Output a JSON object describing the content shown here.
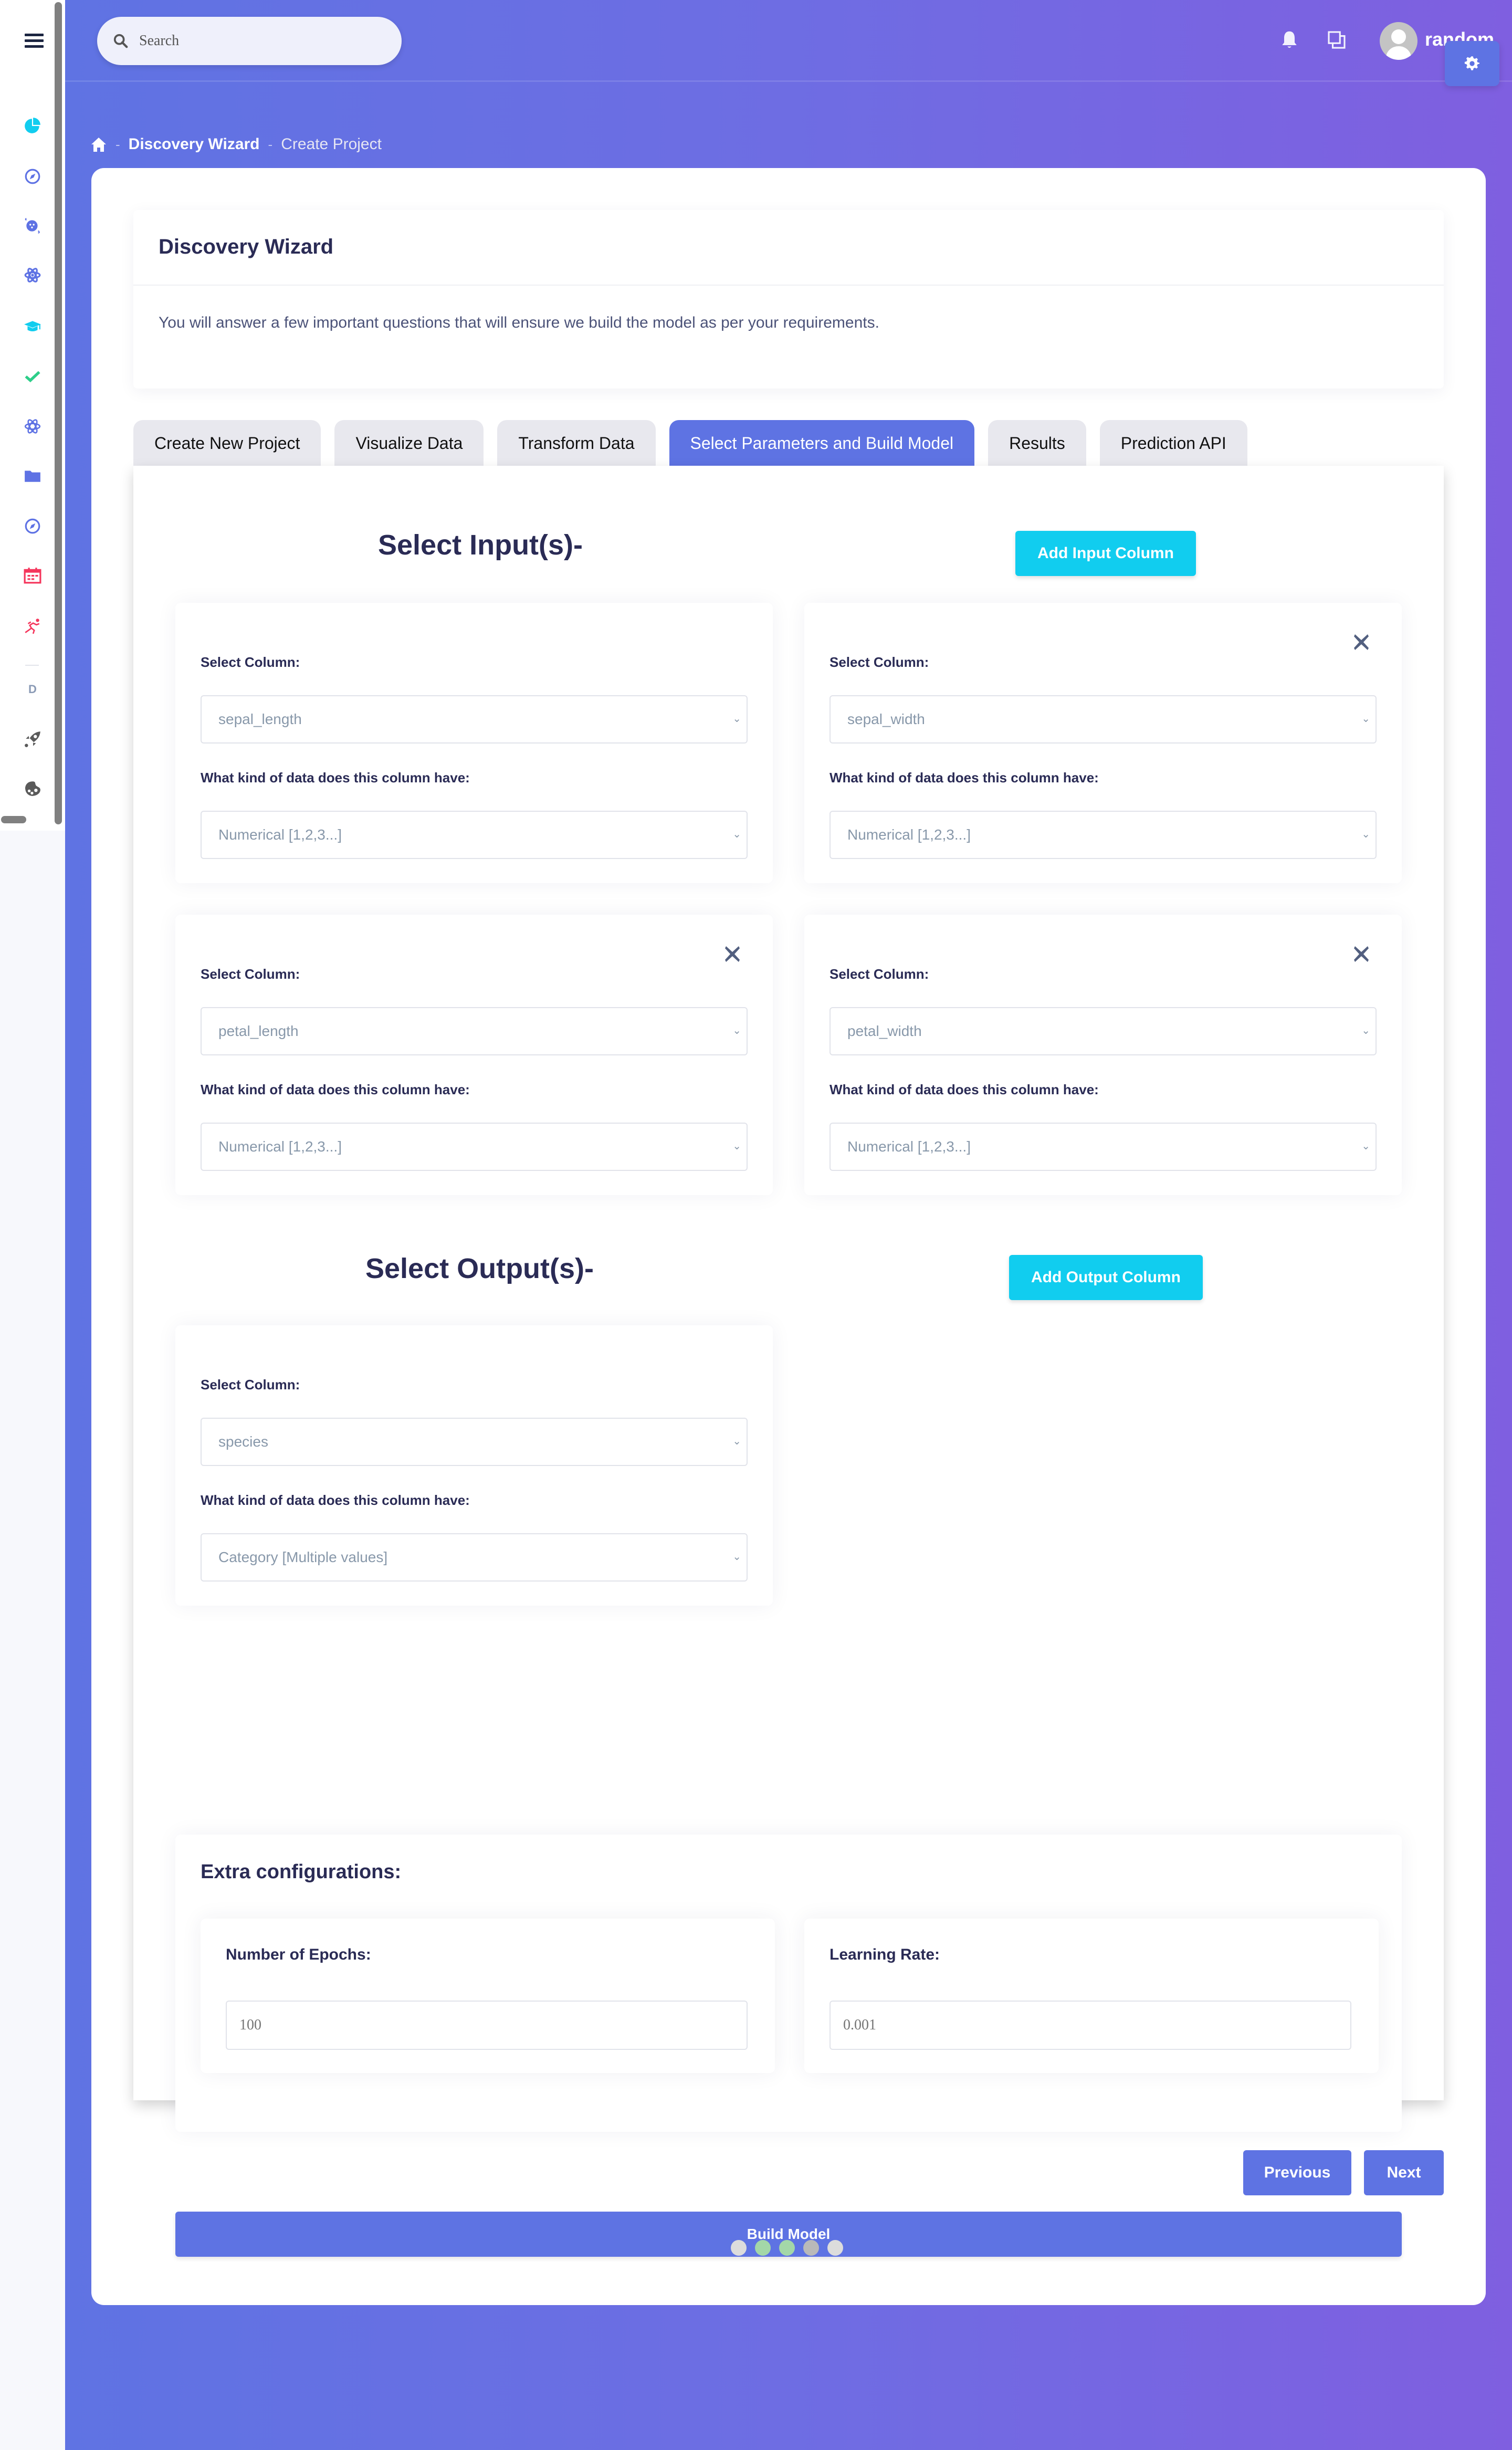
{
  "header": {
    "search_placeholder": "Search",
    "username": "random",
    "icons": [
      "bell-icon",
      "window-restore-icon",
      "user-avatar-icon",
      "gear-icon"
    ]
  },
  "sidebar": {
    "items": [
      {
        "icon": "pie-chart-icon",
        "color": "#11cdef"
      },
      {
        "icon": "compass-icon",
        "color": "#5e72e4"
      },
      {
        "icon": "planet-icon",
        "color": "#5e72e4"
      },
      {
        "icon": "atom-icon",
        "color": "#5e72e4"
      },
      {
        "icon": "graduation-cap-icon",
        "color": "#11cdef"
      },
      {
        "icon": "check-icon",
        "color": "#2dce89"
      },
      {
        "icon": "atom-icon",
        "color": "#5e72e4"
      },
      {
        "icon": "folder-icon",
        "color": "#5e72e4"
      },
      {
        "icon": "compass-icon",
        "color": "#5e72e4"
      },
      {
        "icon": "calendar-icon",
        "color": "#f5365c"
      },
      {
        "icon": "running-icon",
        "color": "#f5365c"
      }
    ],
    "section_letter": "D",
    "extra_items": [
      {
        "icon": "rocket-icon",
        "color": "#5a5a5a"
      },
      {
        "icon": "palette-icon",
        "color": "#5a5a5a"
      }
    ]
  },
  "breadcrumb": {
    "home_icon": "home-icon",
    "items": [
      "Discovery Wizard",
      "Create Project"
    ],
    "separator": "-"
  },
  "wizard": {
    "title": "Discovery Wizard",
    "description": "You will answer a few important questions that will ensure we build the model as per your requirements.",
    "tabs": [
      {
        "label": "Create New Project",
        "active": false
      },
      {
        "label": "Visualize Data",
        "active": false
      },
      {
        "label": "Transform Data",
        "active": false
      },
      {
        "label": "Select Parameters and Build Model",
        "active": true
      },
      {
        "label": "Results",
        "active": false
      },
      {
        "label": "Prediction API",
        "active": false
      }
    ]
  },
  "inputs": {
    "title": "Select Input(s)-",
    "add_button": "Add Input Column",
    "select_column_label": "Select Column:",
    "data_kind_label": "What kind of data does this column have:",
    "columns": [
      {
        "column": "sepal_length",
        "data_type": "Numerical [1,2,3...]",
        "removable": false
      },
      {
        "column": "sepal_width",
        "data_type": "Numerical [1,2,3...]",
        "removable": true
      },
      {
        "column": "petal_length",
        "data_type": "Numerical [1,2,3...]",
        "removable": true
      },
      {
        "column": "petal_width",
        "data_type": "Numerical [1,2,3...]",
        "removable": true
      }
    ]
  },
  "outputs": {
    "title": "Select Output(s)-",
    "add_button": "Add Output Column",
    "select_column_label": "Select Column:",
    "data_kind_label": "What kind of data does this column have:",
    "columns": [
      {
        "column": "species",
        "data_type": "Category [Multiple values]"
      }
    ]
  },
  "extra": {
    "title": "Extra configurations:",
    "epochs_label": "Number of Epochs:",
    "epochs_placeholder": "100",
    "learning_rate_label": "Learning Rate:",
    "learning_rate_placeholder": "0.001"
  },
  "actions": {
    "build_model": "Build Model",
    "previous": "Previous",
    "next": "Next"
  },
  "progress_dots": {
    "total": 5,
    "states": [
      "pending",
      "done",
      "done",
      "current",
      "pending"
    ],
    "colors": {
      "pending": "#dcdcdc",
      "done": "#a3d7a8",
      "current": "#b9b9b9"
    }
  },
  "colors": {
    "primary": "#5e73e3",
    "cyan": "#11cdef",
    "heading": "#2a2b55",
    "muted_text": "#8898aa"
  }
}
